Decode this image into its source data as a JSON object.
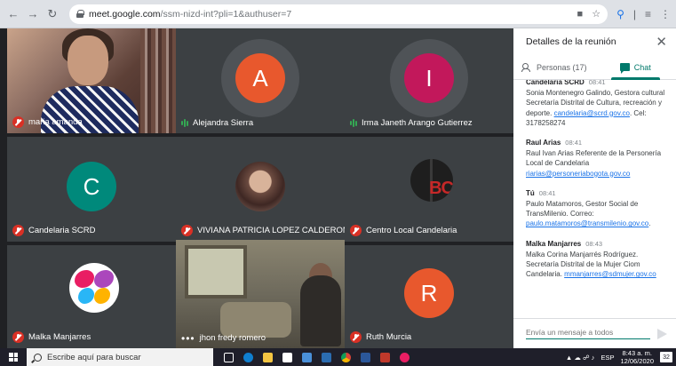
{
  "browser": {
    "url_domain": "meet.google.com",
    "url_path": "/ssm-nizd-int?pli=1&authuser=7"
  },
  "tiles": [
    {
      "name": "maria amanda"
    },
    {
      "name": "Alejandra Sierra",
      "initial": "A",
      "color": "#e8582d"
    },
    {
      "name": "Irma Janeth Arango Gutierrez",
      "initial": "I",
      "color": "#c2185b"
    },
    {
      "name": "Candelaria SCRD",
      "initial": "C",
      "color": "#00897b"
    },
    {
      "name": "VIVIANA PATRICIA LOPEZ CALDERON"
    },
    {
      "name": "Centro Local Candelaria",
      "logo_text": "BC"
    },
    {
      "name": "Malka Manjarres"
    },
    {
      "name": "jhon fredy romero"
    },
    {
      "name": "Ruth Murcia",
      "initial": "R",
      "color": "#e8582d"
    }
  ],
  "panel": {
    "title": "Detalles de la reunión",
    "tab_people": "Personas (17)",
    "tab_chat": "Chat",
    "messages": [
      {
        "sender": "Candelaria SCRD",
        "time": "08:41",
        "text": "Sonia Montenegro Galindo, Gestora cultural Secretaría Distrital de Cultura, recreación y deporte.",
        "link": "candelaria@scrd.gov.co",
        "after": ". Cel: 3178258274"
      },
      {
        "sender": "Raul Arias",
        "time": "08:41",
        "text": "Raul Ivan Arias Referente de la Personería Local de Candelaria",
        "link": "riarias@personeriabogota.gov.co",
        "after": ""
      },
      {
        "sender": "Tú",
        "time": "08:41",
        "text": "Paulo Matamoros, Gestor Social de TransMilenio. Correo:",
        "link": "paulo.matamoros@transmilenio.gov.co",
        "after": "."
      },
      {
        "sender": "Malka Manjarres",
        "time": "08:43",
        "text": "Malka Corina Manjarrés Rodríguez. Secretaría Distrital de la Mujer Ciom Candelaria.",
        "link": "mmanjarres@sdmujer.gov.co",
        "after": ""
      }
    ],
    "compose_placeholder": "Envía un mensaje a todos"
  },
  "taskbar": {
    "search_placeholder": "Escribe aquí para buscar",
    "lang": "ESP",
    "time": "8:43 a. m.",
    "date": "12/06/2020",
    "notifications": "32"
  },
  "colors": {
    "meet_bg": "#202124",
    "accent_teal": "#00796b",
    "mic_off_red": "#d93025"
  }
}
